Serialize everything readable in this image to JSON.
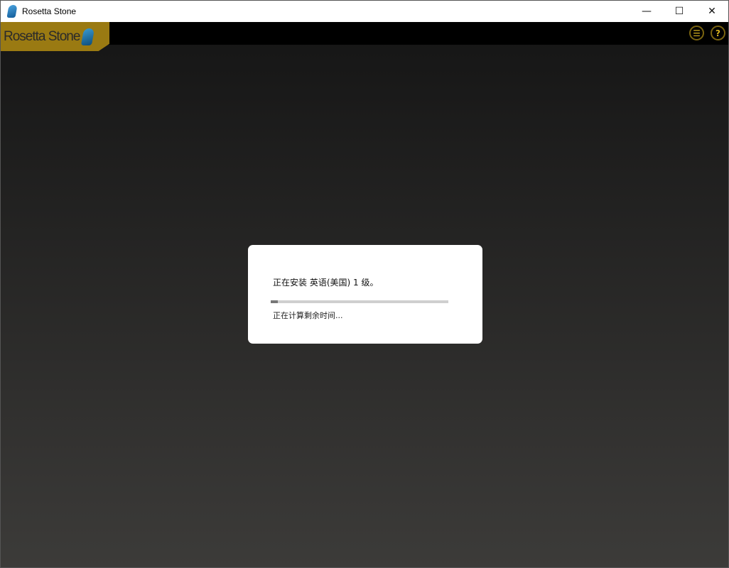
{
  "window": {
    "title": "Rosetta Stone",
    "minimize": "—",
    "maximize": "☐",
    "close": "✕"
  },
  "header": {
    "logo_text": "Rosetta Stone",
    "menu_icon": "list-menu-icon",
    "help_icon": "help-icon",
    "menu_glyph": "☰",
    "help_glyph": "?"
  },
  "dialog": {
    "message": "正在安装 英语(美国) 1 级。",
    "progress_percent": 4,
    "status": "正在计算剩余时间..."
  }
}
